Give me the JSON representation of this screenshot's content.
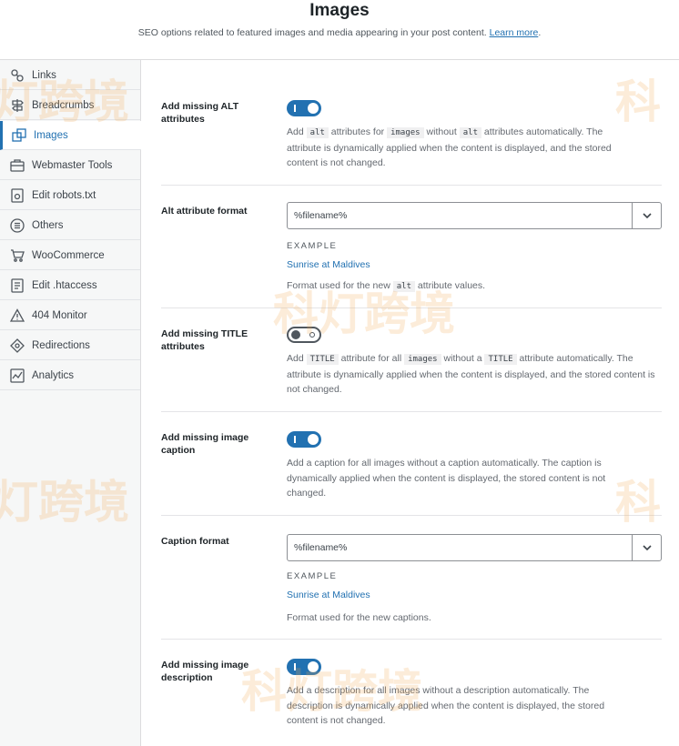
{
  "header": {
    "title": "Images",
    "subtitle": "SEO options related to featured images and media appearing in your post content.",
    "learn_more": "Learn more",
    "end_dot": "."
  },
  "sidebar": {
    "items": [
      {
        "label": "Links",
        "icon": "links-icon"
      },
      {
        "label": "Breadcrumbs",
        "icon": "breadcrumbs-icon"
      },
      {
        "label": "Images",
        "icon": "images-icon",
        "active": true
      },
      {
        "label": "Webmaster Tools",
        "icon": "briefcase-icon"
      },
      {
        "label": "Edit robots.txt",
        "icon": "robots-file-icon"
      },
      {
        "label": "Others",
        "icon": "others-list-icon"
      },
      {
        "label": "WooCommerce",
        "icon": "cart-icon"
      },
      {
        "label": "Edit .htaccess",
        "icon": "htaccess-file-icon"
      },
      {
        "label": "404 Monitor",
        "icon": "warning-triangle-icon"
      },
      {
        "label": "Redirections",
        "icon": "redirections-icon"
      },
      {
        "label": "Analytics",
        "icon": "analytics-chart-icon"
      }
    ]
  },
  "settings": {
    "alt": {
      "label": "Add missing ALT attributes",
      "enabled": true,
      "desc_1": "Add",
      "code_1": "alt",
      "desc_2": "attributes for",
      "code_2": "images",
      "desc_3": "without",
      "code_3": "alt",
      "desc_4": "attributes automatically. The attribute is dynamically applied when the content is displayed, and the stored content is not changed."
    },
    "alt_format": {
      "label": "Alt attribute format",
      "value": "%filename%",
      "example_label": "EXAMPLE",
      "example_value": "Sunrise at Maldives",
      "desc_1": "Format used for the new",
      "code_1": "alt",
      "desc_2": "attribute values."
    },
    "title": {
      "label": "Add missing TITLE attributes",
      "enabled": false,
      "desc_1": "Add",
      "code_1": "TITLE",
      "desc_2": "attribute for all",
      "code_2": "images",
      "desc_3": "without a",
      "code_3": "TITLE",
      "desc_4": "attribute automatically. The attribute is dynamically applied when the content is displayed, and the stored content is not changed."
    },
    "caption": {
      "label": "Add missing image caption",
      "enabled": true,
      "desc": "Add a caption for all images without a caption automatically. The caption is dynamically applied when the content is displayed, the stored content is not changed."
    },
    "caption_format": {
      "label": "Caption format",
      "value": "%filename%",
      "example_label": "EXAMPLE",
      "example_value": "Sunrise at Maldives",
      "desc": "Format used for the new captions."
    },
    "description": {
      "label": "Add missing image description",
      "enabled": true,
      "desc": "Add a description for all images without a description automatically. The description is dynamically applied when the content is displayed, the stored content is not changed."
    }
  },
  "watermark": {
    "text_full": "科灯跨境",
    "text_a": "灯跨境",
    "text_b": "科",
    "color": "#f3aa50"
  },
  "colors": {
    "accent": "#2271b1",
    "sidebar_bg": "#f6f7f7",
    "border": "#dcdcde"
  }
}
